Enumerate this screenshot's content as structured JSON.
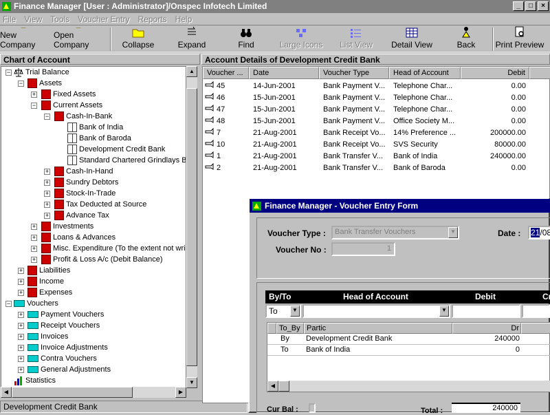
{
  "window": {
    "title": "Finance Manager [User : Administrator]/Onspec Infotech Limited"
  },
  "menu": [
    "File",
    "View",
    "Tools",
    "Voucher Entry",
    "Reports",
    "Help"
  ],
  "toolbar": {
    "new_company": "New Company",
    "open_company": "Open Company",
    "collapse": "Collapse",
    "expand": "Expand",
    "find": "Find",
    "large_icons": "Large Icons",
    "list_view": "List View",
    "detail_view": "Detail View",
    "back": "Back",
    "print_preview": "Print Preview"
  },
  "left_pane": {
    "title": "Chart of Account"
  },
  "tree": {
    "trial_balance": "Trial Balance",
    "assets": "Assets",
    "fixed_assets": "Fixed Assets",
    "current_assets": "Current Assets",
    "cash_in_bank": "Cash-In-Bank",
    "bank_of_india": "Bank of India",
    "bank_of_baroda": "Bank of Baroda",
    "development_credit_bank": "Development Credit Bank",
    "standard_chartered": "Standard Chartered Grindlays B",
    "cash_in_hand": "Cash-In-Hand",
    "sundry_debtors": "Sundry Debtors",
    "stock_in_trade": "Stock-In-Trade",
    "tds": "Tax Deducted at Source",
    "advance_tax": "Advance Tax",
    "investments": "Investments",
    "loans_advances": "Loans & Advances",
    "misc_expenditure": "Misc. Expenditure (To the extent not wri",
    "profit_loss": "Profit & Loss A/c (Debit Balance)",
    "liabilities": "Liabilities",
    "income": "Income",
    "expenses": "Expenses",
    "vouchers": "Vouchers",
    "payment_vouchers": "Payment Vouchers",
    "receipt_vouchers": "Receipt Vouchers",
    "invoices": "Invoices",
    "invoice_adjustments": "Invoice Adjustments",
    "contra_vouchers": "Contra Vouchers",
    "general_adjustments": "General Adjustments",
    "statistics": "Statistics"
  },
  "status": {
    "text": "Development Credit Bank"
  },
  "right_pane": {
    "title": "Account Details of Development Credit Bank"
  },
  "grid": {
    "columns": [
      "Voucher ...",
      "Date",
      "Voucher Type",
      "Head of Account",
      "Debit"
    ],
    "rows": [
      {
        "voucher": "45",
        "date": "14-Jun-2001",
        "type": "Bank Payment V...",
        "head": "Telephone Char...",
        "debit": "0.00"
      },
      {
        "voucher": "46",
        "date": "15-Jun-2001",
        "type": "Bank Payment V...",
        "head": "Telephone Char...",
        "debit": "0.00"
      },
      {
        "voucher": "47",
        "date": "15-Jun-2001",
        "type": "Bank Payment V...",
        "head": "Telephone Char...",
        "debit": "0.00"
      },
      {
        "voucher": "48",
        "date": "15-Jun-2001",
        "type": "Bank Payment V...",
        "head": "Office Society M...",
        "debit": "0.00"
      },
      {
        "voucher": "7",
        "date": "21-Aug-2001",
        "type": "Bank Receipt Vo...",
        "head": "14% Preference ...",
        "debit": "200000.00"
      },
      {
        "voucher": "10",
        "date": "21-Aug-2001",
        "type": "Bank Receipt Vo...",
        "head": "SVS Security",
        "debit": "80000.00"
      },
      {
        "voucher": "1",
        "date": "21-Aug-2001",
        "type": "Bank Transfer V...",
        "head": "Bank of India",
        "debit": "240000.00"
      },
      {
        "voucher": "2",
        "date": "21-Aug-2001",
        "type": "Bank Transfer V...",
        "head": "Bank of Baroda",
        "debit": "0.00"
      }
    ]
  },
  "dialog": {
    "title": "Finance Manager - Voucher Entry Form",
    "voucher_type_label": "Voucher Type :",
    "voucher_type_value": "Bank Transfer Vouchers",
    "date_label": "Date :",
    "date_value_sel": "21",
    "date_value_rest": "/08",
    "voucher_no_label": "Voucher No :",
    "voucher_no_value": "1",
    "entry_header": {
      "by_to": "By/To",
      "head": "Head of Account",
      "debit": "Debit",
      "credit": "Cr"
    },
    "entry_by_to_value": "To",
    "inner_columns": {
      "to_by": "To_By",
      "partic": "Partic",
      "dr": "Dr"
    },
    "inner_rows": [
      {
        "to_by": "By",
        "partic": "Development Credit Bank",
        "dr": "240000"
      },
      {
        "to_by": "To",
        "partic": "Bank of India",
        "dr": "0"
      }
    ],
    "cur_bal_label": "Cur Bal :",
    "total_label": "Total :",
    "total_value": "240000"
  }
}
